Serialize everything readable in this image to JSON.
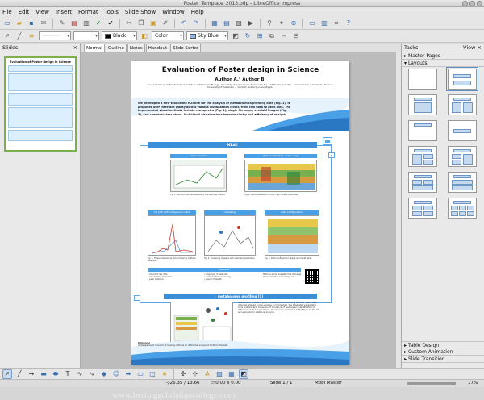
{
  "window": {
    "title": "Poster_Template_2013.odp - LibreOffice Impress"
  },
  "menu": [
    "File",
    "Edit",
    "View",
    "Insert",
    "Format",
    "Tools",
    "Slide Show",
    "Window",
    "Help"
  ],
  "toolbar2": {
    "line_color": "Black",
    "area_style": "Color",
    "area_color": "Sky Blue",
    "accent": "#5aa5e3"
  },
  "slides_pane": {
    "title": "Slides",
    "close": "×"
  },
  "view_tabs": [
    "Normal",
    "Outline",
    "Notes",
    "Handout",
    "Slide Sorter"
  ],
  "poster": {
    "title": "Evaluation of Poster design in Science",
    "author": "Author A.¹ Author B.",
    "affiliation": "Research Group of Bioinformatics, Institute of Molecular Biology, University of Somewhere, Science Park 1, 12345 City, Country — Department of Computer Science, University of Elsewhere — Contact: author@university.edu",
    "abstract": "We developed a new tool called MZmine for the analysis of metabolomics profiling data (Fig. 1). It proposes user interface clarity across various visualization levels, from raw data to peak lists. The implemented visual methods include raw spectra (Fig. 2), single file maps, overlaid images (Fig. 3), and chemical-class views. Multi-level visualizations improve clarity and efficiency of analysis.",
    "section_main": "MZAK",
    "fig_titles": [
      "main window",
      "data visualization colour map",
      "3D plot with comparison data",
      "clustering",
      "data configuration"
    ],
    "features_title": "features",
    "section_bottom": "metabolome profiling [1]",
    "references_label": "References"
  },
  "tasks_pane": {
    "title": "Tasks",
    "view": "View",
    "close": "×",
    "master_pages": "Master Pages",
    "layouts": "Layouts",
    "table_design": "Table Design",
    "custom_animation": "Custom Animation",
    "slide_transition": "Slide Transition"
  },
  "status": {
    "position": "26.35 / 13.66",
    "size": "0.00 x 0.00",
    "slide": "Slide 1 / 1",
    "master": "Mobi Master",
    "zoom": "17%"
  },
  "watermark": "www.heritagechristiancollege.com"
}
